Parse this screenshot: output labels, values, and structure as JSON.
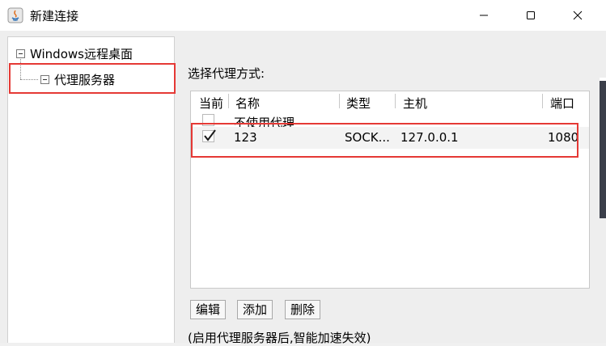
{
  "window": {
    "title": "新建连接",
    "controls": {
      "minimize": "minimize-icon",
      "maximize": "maximize-icon",
      "close": "close-icon"
    }
  },
  "tree": {
    "root_label": "Windows远程桌面",
    "child_label": "代理服务器"
  },
  "proxy": {
    "section_label": "选择代理方式:",
    "columns": [
      "当前",
      "名称",
      "类型",
      "主机",
      "端口"
    ],
    "rows": [
      {
        "checked": false,
        "name": "不使用代理",
        "type": "",
        "host": "",
        "port": ""
      },
      {
        "checked": true,
        "name": "123",
        "type": "SOCK...",
        "host": "127.0.0.1",
        "port": "1080"
      }
    ],
    "buttons": {
      "edit": "编辑",
      "add": "添加",
      "delete": "删除"
    },
    "note": "(启用代理服务器后,智能加速失效)"
  },
  "colors": {
    "highlight": "#e53935",
    "background": "#eeeeee",
    "panel": "#ffffff"
  }
}
